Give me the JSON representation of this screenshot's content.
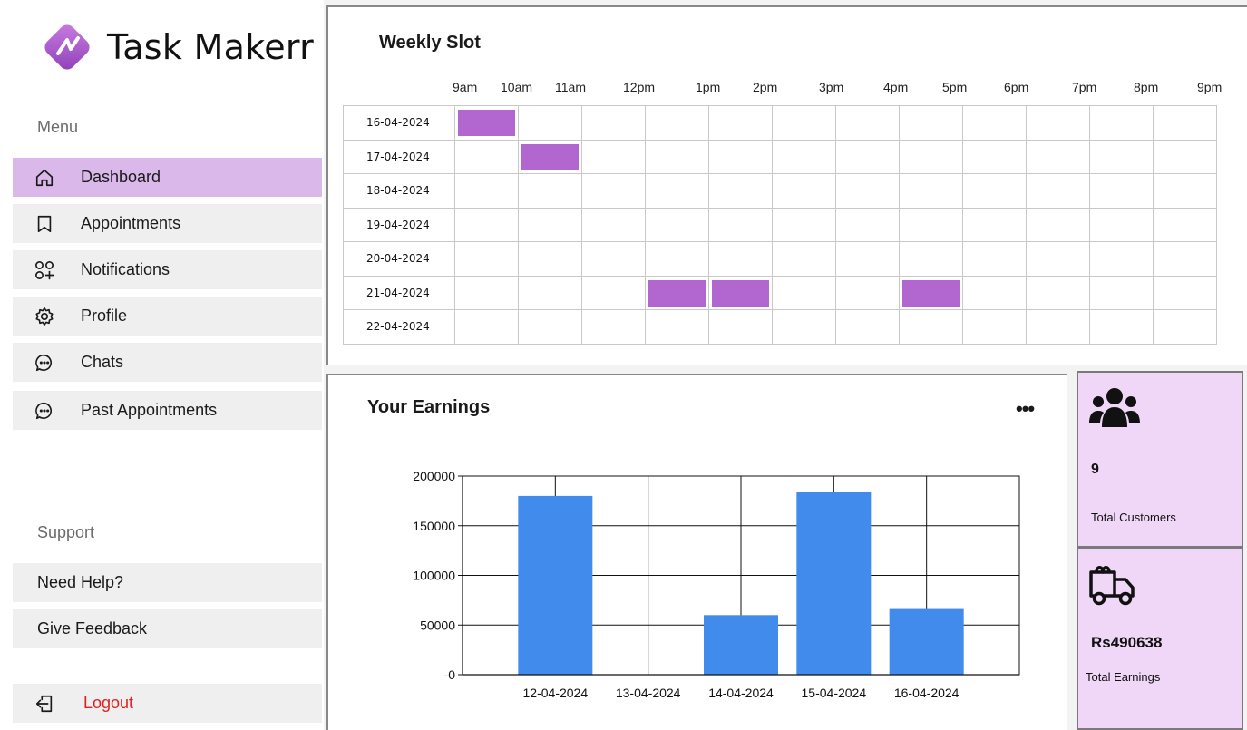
{
  "app": {
    "title": "Task Makerr",
    "brand_color": "#b266cf"
  },
  "sidebar": {
    "menu_label": "Menu",
    "items": [
      {
        "label": "Dashboard",
        "icon": "home-icon",
        "active": true
      },
      {
        "label": "Appointments",
        "icon": "bookmark-icon",
        "active": false
      },
      {
        "label": "Notifications",
        "icon": "apps-add-icon",
        "active": false
      },
      {
        "label": "Profile",
        "icon": "gear-icon",
        "active": false
      },
      {
        "label": "Chats",
        "icon": "chat-icon",
        "active": false
      },
      {
        "label": "Past Appointments",
        "icon": "chat-icon",
        "active": false
      }
    ],
    "support_label": "Support",
    "support_items": [
      {
        "label": "Need Help?"
      },
      {
        "label": "Give Feedback"
      }
    ],
    "logout_label": "Logout",
    "logout_color": "#e02020"
  },
  "weekly_slot": {
    "title": "Weekly Slot",
    "hours": [
      "9am",
      "10am",
      "11am",
      "12pm",
      "1pm",
      "2pm",
      "3pm",
      "4pm",
      "5pm",
      "6pm",
      "7pm",
      "8pm",
      "9pm"
    ],
    "dates": [
      "16-04-2024",
      "17-04-2024",
      "18-04-2024",
      "19-04-2024",
      "20-04-2024",
      "21-04-2024",
      "22-04-2024"
    ],
    "booked_slots": [
      {
        "date": "16-04-2024",
        "hour": "9am"
      },
      {
        "date": "17-04-2024",
        "hour": "10am"
      },
      {
        "date": "21-04-2024",
        "hour": "12pm"
      },
      {
        "date": "21-04-2024",
        "hour": "1pm"
      },
      {
        "date": "21-04-2024",
        "hour": "4pm"
      }
    ],
    "slot_color": "#b266cf"
  },
  "earnings": {
    "title": "Your Earnings",
    "more_label": "•••"
  },
  "chart_data": {
    "type": "bar",
    "title": "",
    "xlabel": "",
    "ylabel": "",
    "categories": [
      "12-04-2024",
      "13-04-2024",
      "14-04-2024",
      "15-04-2024",
      "16-04-2024"
    ],
    "values": [
      180000,
      0,
      60000,
      184500,
      66138
    ],
    "ylim": [
      0,
      200000
    ],
    "yticks": [
      0,
      50000,
      100000,
      150000,
      200000
    ],
    "ytick_labels": [
      "-0",
      "50000",
      "100000",
      "150000",
      "200000"
    ],
    "grid": true,
    "bar_color": "#418bed"
  },
  "stats": {
    "customers": {
      "value": "9",
      "label": "Total Customers",
      "icon": "users-icon"
    },
    "earnings": {
      "value": "Rs490638",
      "label": "Total Earnings",
      "icon": "delivery-truck-icon"
    }
  }
}
